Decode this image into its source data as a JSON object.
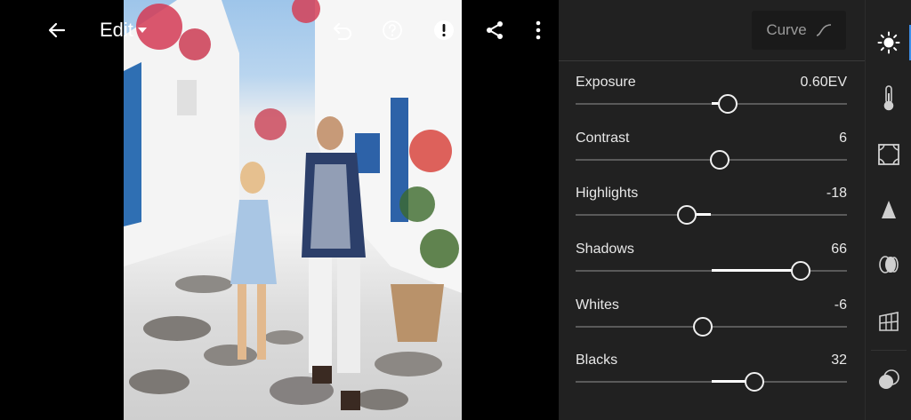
{
  "toolbar": {
    "edit_label": "Edit",
    "icons": [
      "back-arrow-icon",
      "caret-down-icon",
      "undo-icon",
      "help-icon",
      "alert-icon",
      "share-icon",
      "more-icon"
    ]
  },
  "panel": {
    "curve_label": "Curve",
    "sliders": [
      {
        "label": "Exposure",
        "value": "0.60EV",
        "position": 0.56
      },
      {
        "label": "Contrast",
        "value": "6",
        "position": 0.53
      },
      {
        "label": "Highlights",
        "value": "-18",
        "position": 0.41
      },
      {
        "label": "Shadows",
        "value": "66",
        "position": 0.83
      },
      {
        "label": "Whites",
        "value": "-6",
        "position": 0.47
      },
      {
        "label": "Blacks",
        "value": "32",
        "position": 0.66
      }
    ]
  },
  "toolstrip": {
    "tools": [
      "light-icon",
      "color-thermometer-icon",
      "effects-icon",
      "detail-icon",
      "optics-icon",
      "geometry-icon",
      "masking-icon"
    ],
    "active": "light-icon",
    "accent": "#3b8ee8"
  }
}
